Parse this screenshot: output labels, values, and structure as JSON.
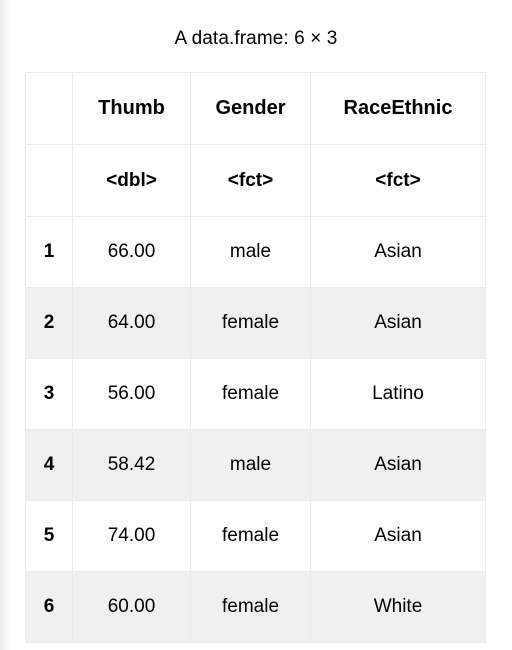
{
  "caption": "A data.frame: 6 × 3",
  "table": {
    "index_header": "",
    "columns": [
      "Thumb",
      "Gender",
      "RaceEthnic"
    ],
    "types": [
      "<dbl>",
      "<fct>",
      "<fct>"
    ],
    "row_labels": [
      "1",
      "2",
      "3",
      "4",
      "5",
      "6"
    ],
    "rows": [
      [
        "66.00",
        "male",
        "Asian"
      ],
      [
        "64.00",
        "female",
        "Asian"
      ],
      [
        "56.00",
        "female",
        "Latino"
      ],
      [
        "58.42",
        "male",
        "Asian"
      ],
      [
        "74.00",
        "female",
        "Asian"
      ],
      [
        "60.00",
        "female",
        "White"
      ]
    ]
  },
  "colors": {
    "text": "#000000",
    "grid": "#ebebeb",
    "stripe": "#f0f0f0",
    "background": "#ffffff"
  }
}
